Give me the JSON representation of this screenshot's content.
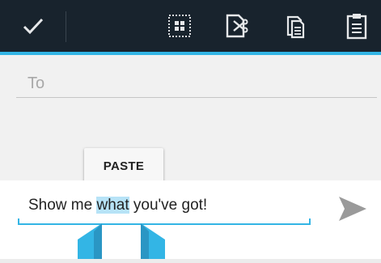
{
  "action_bar": {
    "done": "done-checkmark",
    "actions": [
      "select-all",
      "cut",
      "copy",
      "paste"
    ]
  },
  "compose": {
    "to_placeholder": "To",
    "paste_label": "PASTE",
    "message_before": "Show me ",
    "message_selected": "what",
    "message_after": " you've got!"
  },
  "colors": {
    "accent": "#33b5e5",
    "action_bar": "#18232d",
    "selection": "#b7e3f7"
  }
}
